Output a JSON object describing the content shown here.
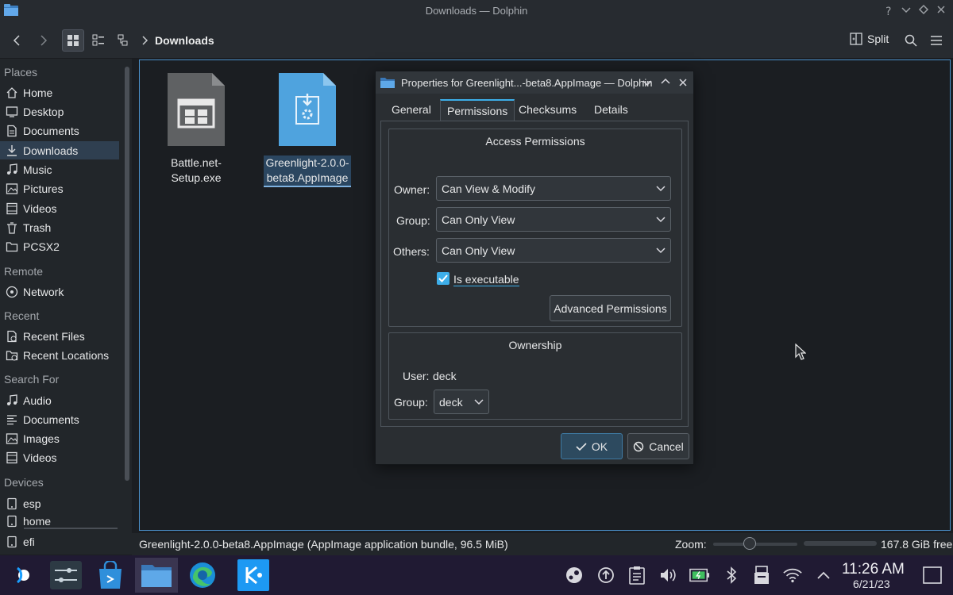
{
  "window": {
    "title": "Downloads — Dolphin"
  },
  "toolbar": {
    "breadcrumb": "Downloads",
    "split_label": "Split"
  },
  "sidebar": {
    "sections": [
      {
        "label": "Places",
        "items": [
          {
            "label": "Home",
            "icon": "home-icon"
          },
          {
            "label": "Desktop",
            "icon": "desktop-icon"
          },
          {
            "label": "Documents",
            "icon": "documents-icon"
          },
          {
            "label": "Downloads",
            "icon": "downloads-icon",
            "selected": true
          },
          {
            "label": "Music",
            "icon": "music-icon"
          },
          {
            "label": "Pictures",
            "icon": "pictures-icon"
          },
          {
            "label": "Videos",
            "icon": "videos-icon"
          },
          {
            "label": "Trash",
            "icon": "trash-icon"
          },
          {
            "label": "PCSX2",
            "icon": "folder-icon"
          }
        ]
      },
      {
        "label": "Remote",
        "items": [
          {
            "label": "Network",
            "icon": "network-icon"
          }
        ]
      },
      {
        "label": "Recent",
        "items": [
          {
            "label": "Recent Files",
            "icon": "recent-files-icon"
          },
          {
            "label": "Recent Locations",
            "icon": "recent-locations-icon"
          }
        ]
      },
      {
        "label": "Search For",
        "items": [
          {
            "label": "Audio",
            "icon": "audio-icon"
          },
          {
            "label": "Documents",
            "icon": "documents-search-icon"
          },
          {
            "label": "Images",
            "icon": "images-icon"
          },
          {
            "label": "Videos",
            "icon": "videos-search-icon"
          }
        ]
      },
      {
        "label": "Devices",
        "items": [
          {
            "label": "esp",
            "icon": "drive-icon"
          },
          {
            "label": "home",
            "icon": "drive-icon"
          },
          {
            "label": "efi",
            "icon": "drive-icon"
          }
        ]
      }
    ]
  },
  "files": [
    {
      "name": "Battle.net-Setup.exe",
      "icon": "exe-file-icon"
    },
    {
      "name_line1": "Greenlight-2.0.0-",
      "name_line2": "beta8.AppImage",
      "icon": "appimage-file-icon",
      "selected": true
    }
  ],
  "statusbar": {
    "text": "Greenlight-2.0.0-beta8.AppImage (AppImage application bundle, 96.5 MiB)",
    "zoom_label": "Zoom:",
    "free_space": "167.8 GiB free"
  },
  "taskbar": {
    "time": "11:26 AM",
    "date": "6/21/23"
  },
  "dialog": {
    "title": "Properties for Greenlight...-beta8.AppImage — Dolphin",
    "tabs": [
      "General",
      "Permissions",
      "Checksums",
      "Details"
    ],
    "active_tab": "Permissions",
    "access": {
      "title": "Access Permissions",
      "owner_label": "Owner:",
      "owner_value": "Can View & Modify",
      "group_label": "Group:",
      "group_value": "Can Only View",
      "others_label": "Others:",
      "others_value": "Can Only View",
      "executable_label": "Is executable",
      "executable_checked": true,
      "advanced_button": "Advanced Permissions"
    },
    "ownership": {
      "title": "Ownership",
      "user_label": "User:",
      "user_value": "deck",
      "group_label": "Group:",
      "group_value": "deck"
    },
    "ok_label": "OK",
    "cancel_label": "Cancel"
  },
  "colors": {
    "accent": "#3daee9",
    "selection": "#2f3f50",
    "taskbar": "#201a33"
  }
}
